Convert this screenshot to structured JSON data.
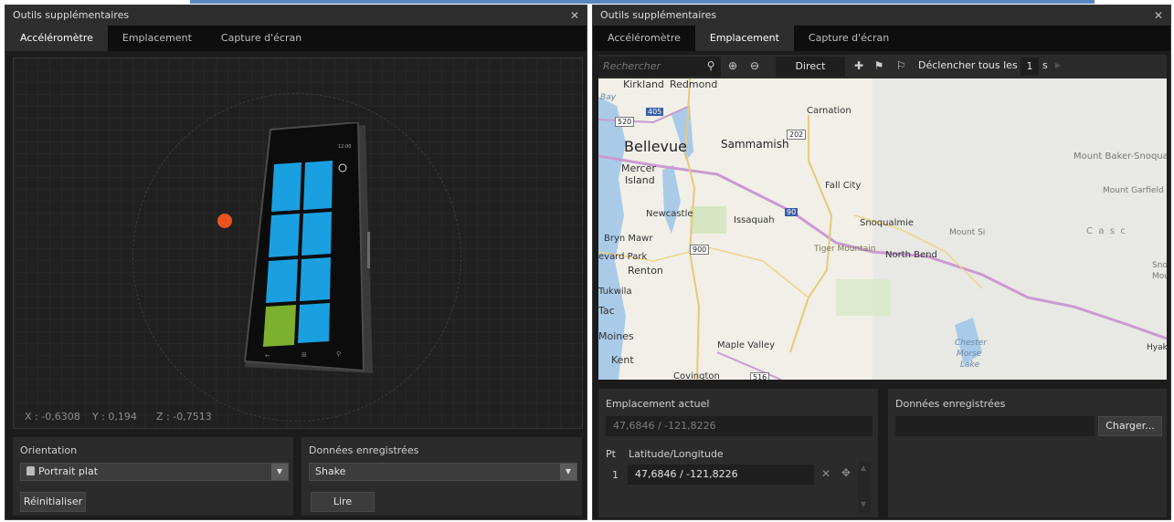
{
  "left": {
    "title": "Outils supplémentaires",
    "tabs": [
      "Accéléromètre",
      "Emplacement",
      "Capture d'écran"
    ],
    "readouts": {
      "x": "X : -0,6308",
      "y": "Y : 0,194",
      "z": "Z : -0,7513"
    },
    "orientation": {
      "label": "Orientation",
      "value": "Portrait plat",
      "reset": "Réinitialiser"
    },
    "recorded": {
      "label": "Données enregistrées",
      "value": "Shake",
      "play": "Lire"
    }
  },
  "right": {
    "title": "Outils supplémentaires",
    "tabs": [
      "Accéléromètre",
      "Emplacement",
      "Capture d'écran"
    ],
    "toolbar": {
      "search_placeholder": "Rechercher",
      "direct": "Direct",
      "trigger": "Déclencher tous les",
      "interval": "1",
      "unit": "s"
    },
    "map": {
      "places": [
        "Kirkland",
        "Redmond",
        "Bay",
        "Carnation",
        "Bellevue",
        "Sammamish",
        "Mercer",
        "Island",
        "Fall City",
        "Newcastle",
        "Issaquah",
        "Snoqualmie",
        "Bryn Mawr",
        "Renton",
        "Tiger Mountain",
        "North Bend",
        "Mount Si",
        "Mount Baker-Snoqual",
        "Mount Garfield",
        "Tukwila",
        "Maple Valley",
        "Kent",
        "Covington",
        "Chester",
        "Morse",
        "Lake",
        "Hyak",
        "Tac",
        "Moines",
        "evard Park",
        "Snoq",
        "Mou",
        "C  a  s  c"
      ],
      "shields": [
        "520",
        "405",
        "202",
        "90",
        "900",
        "516"
      ]
    },
    "current": {
      "label": "Emplacement actuel",
      "value": "47,6846 / -121,8226"
    },
    "points": {
      "col_pt": "Pt",
      "col_latlon": "Latitude/Longitude",
      "rows": [
        {
          "n": "1",
          "value": "47,6846 / -121,8226"
        }
      ]
    },
    "recorded": {
      "label": "Données enregistrées",
      "load": "Charger..."
    }
  }
}
